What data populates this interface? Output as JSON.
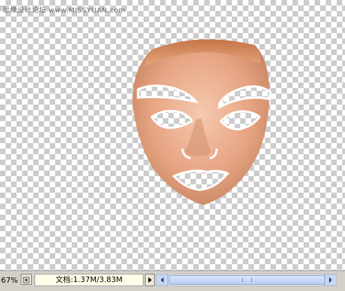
{
  "watermark": {
    "text": "思缘设计论坛 www.MISSYUAN.com"
  },
  "canvas": {
    "description_hidden": true
  },
  "status_bar": {
    "zoom": "67%",
    "doc_info": "文档:1.37M/3.83M"
  },
  "icons": {
    "status_icon": "doc-status-icon",
    "menu_arrow": "triangle-right-icon",
    "scroll_left": "scroll-left-arrow-icon",
    "scroll_right": "scroll-right-arrow-icon"
  },
  "colors": {
    "skin": "#e8a887",
    "status_bg": "#d4d0c8",
    "scroll_blue": "#b9cdf3"
  }
}
